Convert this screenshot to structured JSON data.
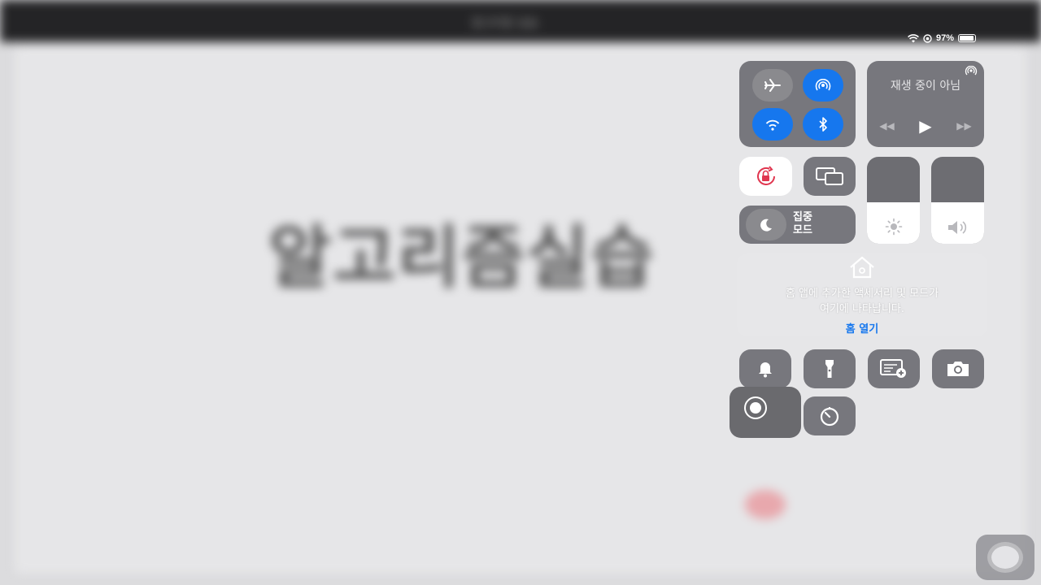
{
  "background_app": {
    "title": "알고리즘실습",
    "window_title": "알고리즘 실습"
  },
  "status_bar": {
    "icons": [
      "wifi-icon",
      "location-icon"
    ],
    "battery_percent": "97%",
    "battery_level": 0.97
  },
  "connectivity": {
    "airplane_mode": false,
    "airdrop_hotspot": true,
    "wifi": true,
    "bluetooth": true
  },
  "now_playing": {
    "title": "재생 중이 아님",
    "controls": [
      "rewind-icon",
      "play-icon",
      "fast-forward-icon"
    ]
  },
  "focus": {
    "label_line1": "집중",
    "label_line2": "모드"
  },
  "brightness": {
    "level": 0.48
  },
  "volume": {
    "level": 0.48
  },
  "home": {
    "text_line1": "홈 앱에 추가한 액세서리 및 모드가",
    "text_line2": "여기에 나타납니다.",
    "open_label": "홈 열기"
  },
  "colors": {
    "accent": "#1677ee",
    "orientation_lock": "#e0364f",
    "tile": "#6e6e73",
    "background": "#dcdcde"
  }
}
